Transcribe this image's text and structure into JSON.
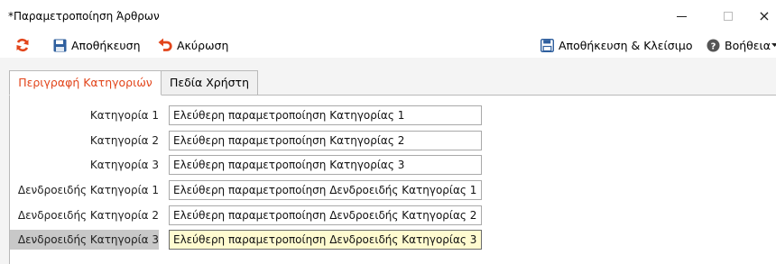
{
  "window": {
    "title": "*Παραμετροποίηση Άρθρων",
    "min_label": "",
    "close_label": "×"
  },
  "toolbar": {
    "save_label": "Αποθήκευση",
    "cancel_label": "Ακύρωση",
    "save_close_label": "Αποθήκευση & Κλείσιμο",
    "help_label": "Βοήθεια",
    "colors": {
      "refresh": "#e2451b",
      "save": "#2f5f9e",
      "cancel": "#e2451b",
      "help": "#555555"
    },
    "icons": [
      "refresh-icon",
      "save-icon",
      "undo-icon",
      "save-close-icon",
      "help-icon"
    ]
  },
  "tabs": [
    {
      "label": "Περιγραφή Κατηγοριών",
      "active": true
    },
    {
      "label": "Πεδία Χρήστη",
      "active": false
    }
  ],
  "fields": [
    {
      "label": "Κατηγορία 1",
      "value": "Ελεύθερη παραμετροποίηση Κατηγορίας 1"
    },
    {
      "label": "Κατηγορία 2",
      "value": "Ελεύθερη παραμετροποίηση Κατηγορίας 2"
    },
    {
      "label": "Κατηγορία 3",
      "value": "Ελεύθερη παραμετροποίηση Κατηγορίας 3"
    },
    {
      "label": "Δενδροειδής Κατηγορία 1",
      "value": "Ελεύθερη παραμετροποίηση Δενδροειδής Κατηγορίας 1"
    },
    {
      "label": "Δενδροειδής Κατηγορία 2",
      "value": "Ελεύθερη παραμετροποίηση Δενδροειδής Κατηγορίας 2"
    },
    {
      "label": "Δενδροειδής Κατηγορία 3",
      "value": "Ελεύθερη παραμετροποίηση Δενδροειδής Κατηγορίας 3",
      "focused": true
    }
  ],
  "colors": {
    "active_tab_text": "#e2451b",
    "focused_input_bg": "#fffbd0",
    "focused_label_bg": "#c8c8c8"
  }
}
